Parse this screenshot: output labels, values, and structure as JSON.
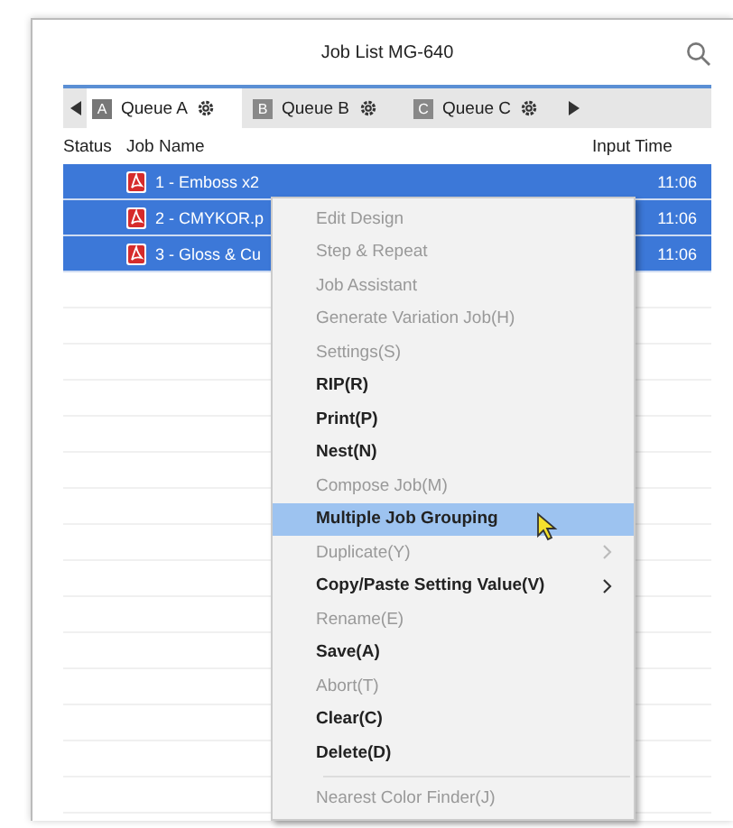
{
  "window": {
    "title": "Job List MG-640"
  },
  "tabs": [
    {
      "letter": "A",
      "label": "Queue A",
      "selected": true
    },
    {
      "letter": "B",
      "label": "Queue B",
      "selected": false
    },
    {
      "letter": "C",
      "label": "Queue C",
      "selected": false
    }
  ],
  "table": {
    "columns": [
      "Status",
      "Job Name",
      "Input Time"
    ],
    "rows": [
      {
        "name": "1 - Emboss x2",
        "time": "11:06",
        "selected": true
      },
      {
        "name": "2 - CMYKOR.p",
        "time": "11:06",
        "selected": true
      },
      {
        "name": "3 - Gloss & Cu",
        "time": "11:06",
        "selected": true
      }
    ]
  },
  "context_menu": {
    "items": [
      {
        "label": "Edit Design",
        "disabled": true,
        "selected": false
      },
      {
        "label": "Step & Repeat",
        "disabled": true,
        "selected": false
      },
      {
        "label": "Job Assistant",
        "disabled": true,
        "selected": false
      },
      {
        "label": "Generate Variation Job(H)",
        "disabled": true,
        "selected": false
      },
      {
        "label": "Settings(S)",
        "disabled": true,
        "selected": false
      },
      {
        "label": "RIP(R)",
        "disabled": false,
        "selected": false
      },
      {
        "label": "Print(P)",
        "disabled": false,
        "selected": false
      },
      {
        "label": "Nest(N)",
        "disabled": false,
        "selected": false
      },
      {
        "label": "Compose Job(M)",
        "disabled": true,
        "selected": false
      },
      {
        "label": "Multiple Job Grouping",
        "disabled": false,
        "selected": true
      },
      {
        "label": "Duplicate(Y)",
        "disabled": true,
        "selected": false,
        "submenu": true
      },
      {
        "label": "Copy/Paste Setting Value(V)",
        "disabled": false,
        "selected": false,
        "submenu": true
      },
      {
        "label": "Rename(E)",
        "disabled": true,
        "selected": false
      },
      {
        "label": "Save(A)",
        "disabled": false,
        "selected": false
      },
      {
        "label": "Abort(T)",
        "disabled": true,
        "selected": false
      },
      {
        "label": "Clear(C)",
        "disabled": false,
        "selected": false
      },
      {
        "label": "Delete(D)",
        "disabled": false,
        "selected": false
      },
      {
        "label": "Nearest Color Finder(J)",
        "disabled": true,
        "selected": false,
        "separator_before": true
      }
    ]
  }
}
